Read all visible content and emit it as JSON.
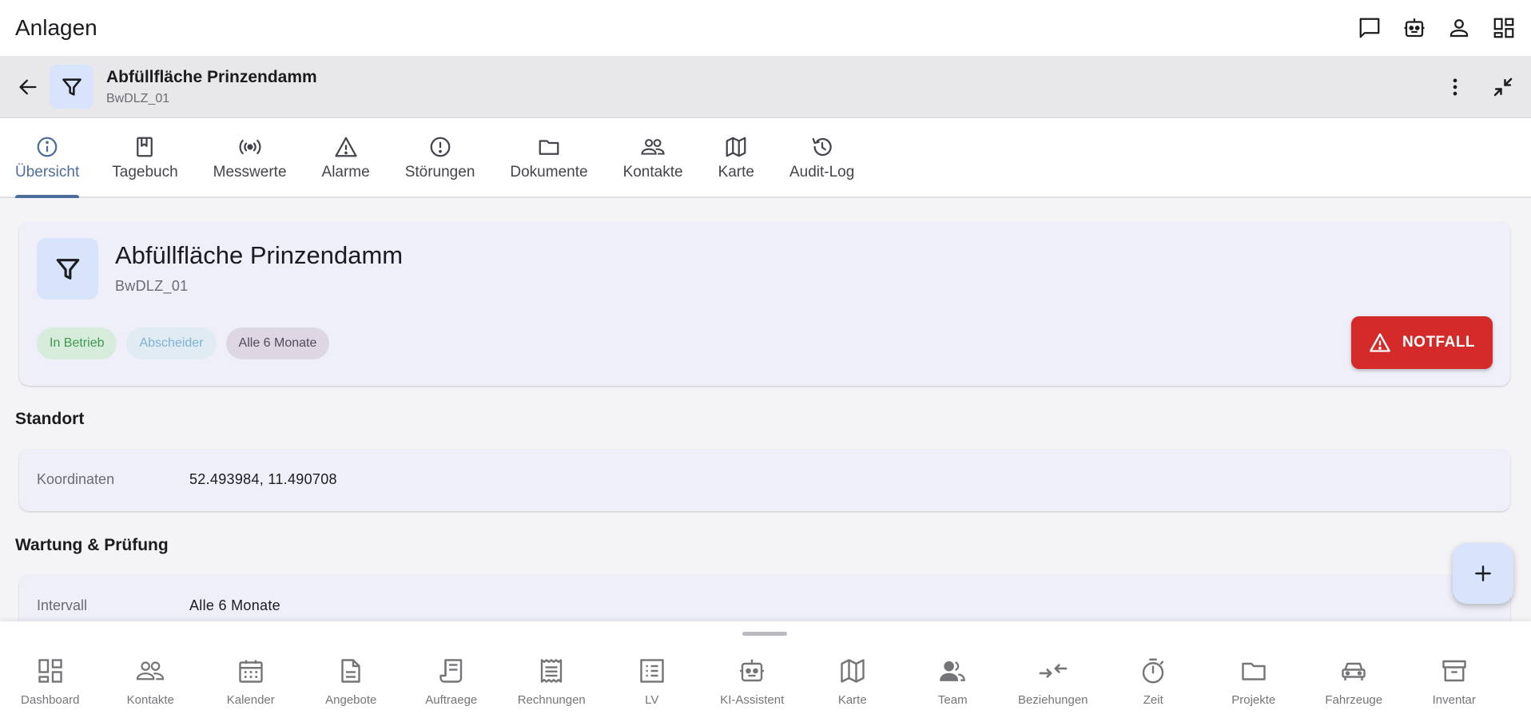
{
  "appbar": {
    "title": "Anlagen",
    "actions": [
      "chat-icon",
      "robot-icon",
      "person-icon",
      "dashboard-icon"
    ]
  },
  "detail": {
    "title": "Abfüllfläche Prinzendamm",
    "subtitle": "BwDLZ_01"
  },
  "tabs": [
    {
      "label": "Übersicht",
      "icon": "info-icon",
      "active": true
    },
    {
      "label": "Tagebuch",
      "icon": "bookmark-book-icon"
    },
    {
      "label": "Messwerte",
      "icon": "sensor-icon"
    },
    {
      "label": "Alarme",
      "icon": "warning-icon"
    },
    {
      "label": "Störungen",
      "icon": "error-icon"
    },
    {
      "label": "Dokumente",
      "icon": "folder-icon"
    },
    {
      "label": "Kontakte",
      "icon": "people-icon"
    },
    {
      "label": "Karte",
      "icon": "map-icon"
    },
    {
      "label": "Audit-Log",
      "icon": "history-icon"
    }
  ],
  "overview": {
    "name": "Abfüllfläche Prinzendamm",
    "code": "BwDLZ_01",
    "chips": [
      {
        "label": "In Betrieb",
        "color": "#3d9a4f"
      },
      {
        "label": "Abscheider",
        "color": "#7fb2d4"
      },
      {
        "label": "Alle 6 Monate",
        "color": "#514a5b"
      }
    ],
    "emergency_label": "NOTFALL",
    "emergency_color": "#d42a2a"
  },
  "standort": {
    "title": "Standort",
    "key": "Koordinaten",
    "value": "52.493984, 11.490708"
  },
  "wartung": {
    "title": "Wartung & Prüfung",
    "key": "Intervall",
    "value": "Alle 6 Monate"
  },
  "bottom_nav": [
    {
      "label": "Dashboard",
      "icon": "dashboard-icon"
    },
    {
      "label": "Kontakte",
      "icon": "people-icon"
    },
    {
      "label": "Kalender",
      "icon": "calendar-icon"
    },
    {
      "label": "Angebote",
      "icon": "document-icon"
    },
    {
      "label": "Auftraege",
      "icon": "receipt-icon"
    },
    {
      "label": "Rechnungen",
      "icon": "invoice-icon"
    },
    {
      "label": "LV",
      "icon": "list-icon"
    },
    {
      "label": "KI-Assistent",
      "icon": "robot-icon"
    },
    {
      "label": "Karte",
      "icon": "map-icon"
    },
    {
      "label": "Team",
      "icon": "team-icon"
    },
    {
      "label": "Beziehungen",
      "icon": "relations-icon"
    },
    {
      "label": "Zeit",
      "icon": "timer-icon"
    },
    {
      "label": "Projekte",
      "icon": "folder-icon"
    },
    {
      "label": "Fahrzeuge",
      "icon": "car-icon"
    },
    {
      "label": "Inventar",
      "icon": "archive-icon"
    }
  ]
}
